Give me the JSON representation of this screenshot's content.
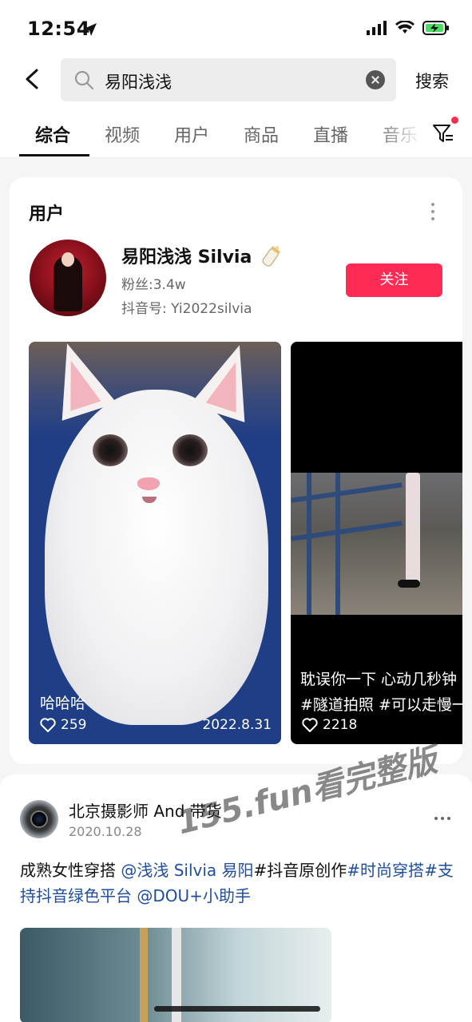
{
  "status": {
    "time": "12:54"
  },
  "search": {
    "query": "易阳浅浅",
    "submit_label": "搜索"
  },
  "tabs": [
    {
      "label": "综合",
      "active": true
    },
    {
      "label": "视频"
    },
    {
      "label": "用户"
    },
    {
      "label": "商品"
    },
    {
      "label": "直播"
    },
    {
      "label": "音乐"
    }
  ],
  "user_section": {
    "title": "用户",
    "name": "易阳浅浅 Silvia",
    "fans": "粉丝:3.4w",
    "douyin_id": "抖音号: Yi2022silvia",
    "follow_label": "关注"
  },
  "videos": [
    {
      "caption": "哈哈哈",
      "likes": "259",
      "date": "2022.8.31"
    },
    {
      "caption_line1": "耽误你一下 心动几秒钟",
      "caption_line2": "#隧道拍照 #可以走慢一点吗",
      "likes": "2218"
    }
  ],
  "post": {
    "author": "北京摄影师 And 带货",
    "date": "2020.10.28",
    "text_plain1": "成熟女性穿搭 ",
    "mention1": "@浅浅 Silvia 易阳",
    "text_plain2": "#抖音原创作",
    "tag1": "#时尚穿搭",
    "tag2": "#支持抖音绿色平台",
    "mention2": " @DOU+小助手"
  },
  "watermark": "155.fun看完整版",
  "colors": {
    "accent": "#fe2c55",
    "link": "#1f4e9c"
  }
}
